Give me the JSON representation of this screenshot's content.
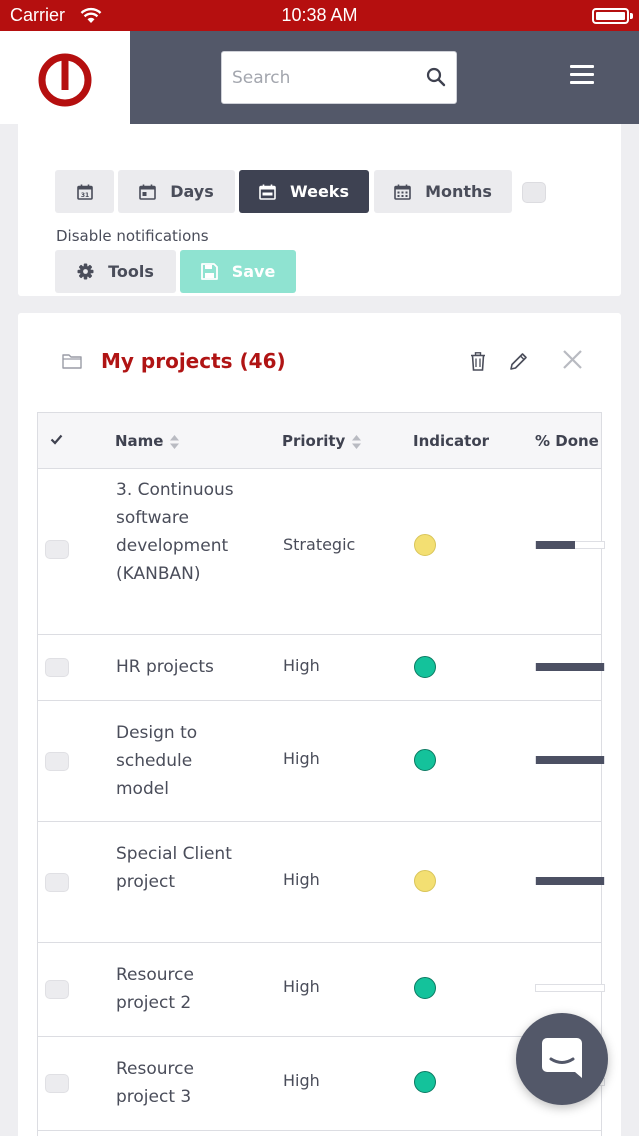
{
  "status_bar": {
    "carrier": "Carrier",
    "time": "10:38 AM"
  },
  "header": {
    "search_placeholder": "Search"
  },
  "toolbar": {
    "buttons": [
      {
        "label": "",
        "icon": "calendar-31-icon",
        "active": false
      },
      {
        "label": "Days",
        "icon": "calendar-day-icon",
        "active": false
      },
      {
        "label": "Weeks",
        "icon": "calendar-week-icon",
        "active": true
      },
      {
        "label": "Months",
        "icon": "calendar-month-icon",
        "active": false
      }
    ],
    "disable_notifications_label": "Disable notifications",
    "tools_label": "Tools",
    "save_label": "Save"
  },
  "projects": {
    "title": "My projects (46)",
    "columns": [
      "Name",
      "Priority",
      "Indicator",
      "% Done"
    ],
    "rows": [
      {
        "name": "3. Continuous software development (KANBAN)",
        "priority": "Strategic",
        "indicator": "yellow",
        "done": 0.58
      },
      {
        "name": "HR projects",
        "priority": "High",
        "indicator": "green",
        "done": 1.0
      },
      {
        "name": "Design to schedule model",
        "priority": "High",
        "indicator": "green",
        "done": 1.0
      },
      {
        "name": "Special Client project",
        "priority": "High",
        "indicator": "yellow",
        "done": 1.0
      },
      {
        "name": "Resource project 2",
        "priority": "High",
        "indicator": "green",
        "done": 0.0
      },
      {
        "name": "Resource project 3",
        "priority": "High",
        "indicator": "green",
        "done": 0.0
      }
    ]
  },
  "colors": {
    "brand_red": "#b50f0f",
    "header_slate": "#535869",
    "active_button": "#3e4252",
    "save_teal": "#8fe3d1",
    "indicator_yellow": "#f3df72",
    "indicator_green": "#14c29b"
  }
}
